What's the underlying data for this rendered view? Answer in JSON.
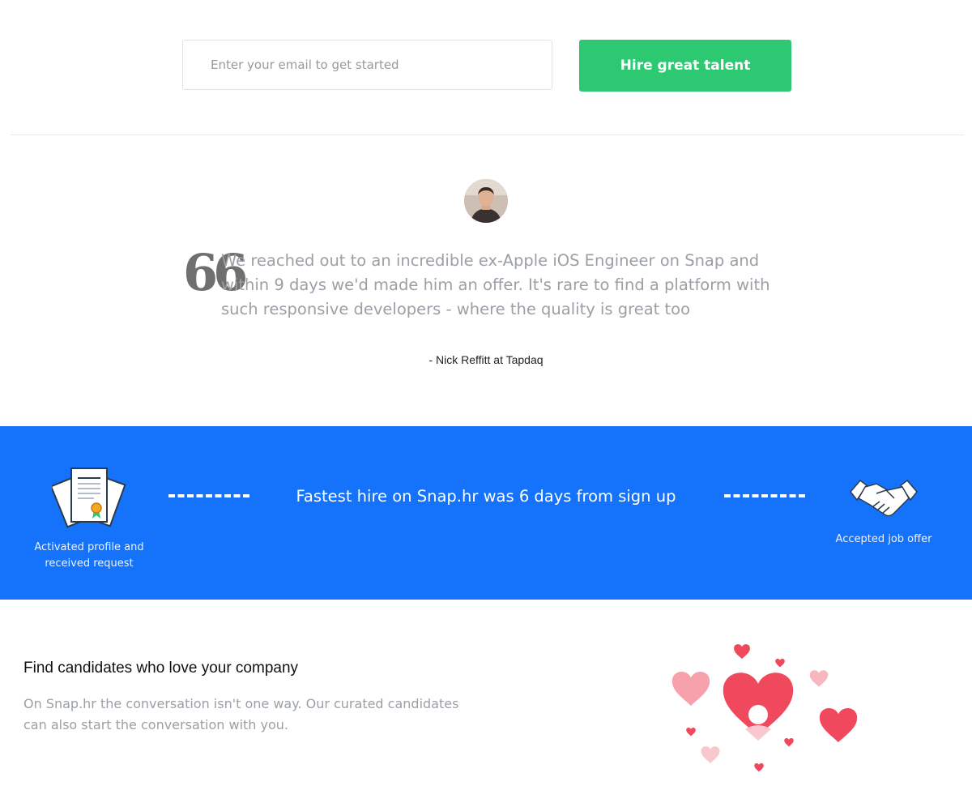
{
  "signup": {
    "email_placeholder": "Enter your email to get started",
    "cta_label": "Hire great talent"
  },
  "testimonial": {
    "quote_mark": "66",
    "quote": "We reached out to an incredible ex-Apple iOS Engineer on Snap and within 9 days we'd made him an offer. It's rare to find a platform with such responsive developers - where the quality is great too",
    "author": "- Nick Reffitt at Tapdaq"
  },
  "stats": {
    "left_caption": "Activated profile and received request",
    "headline": "Fastest hire on Snap.hr was 6 days from sign up",
    "right_caption": "Accepted job offer",
    "band_color": "#1473fa",
    "left_icon": "certificate-icon",
    "right_icon": "handshake-icon"
  },
  "feature": {
    "title": "Find candidates who love your company",
    "description": "On Snap.hr the conversation isn't one way. Our curated candidates can also start the conversation with you.",
    "illustration": "hearts-illustration"
  },
  "colors": {
    "cta_green": "#2dc872",
    "accent_blue": "#1473fa",
    "heart_red": "#f0485c",
    "heart_pink": "#f7a1ad"
  }
}
